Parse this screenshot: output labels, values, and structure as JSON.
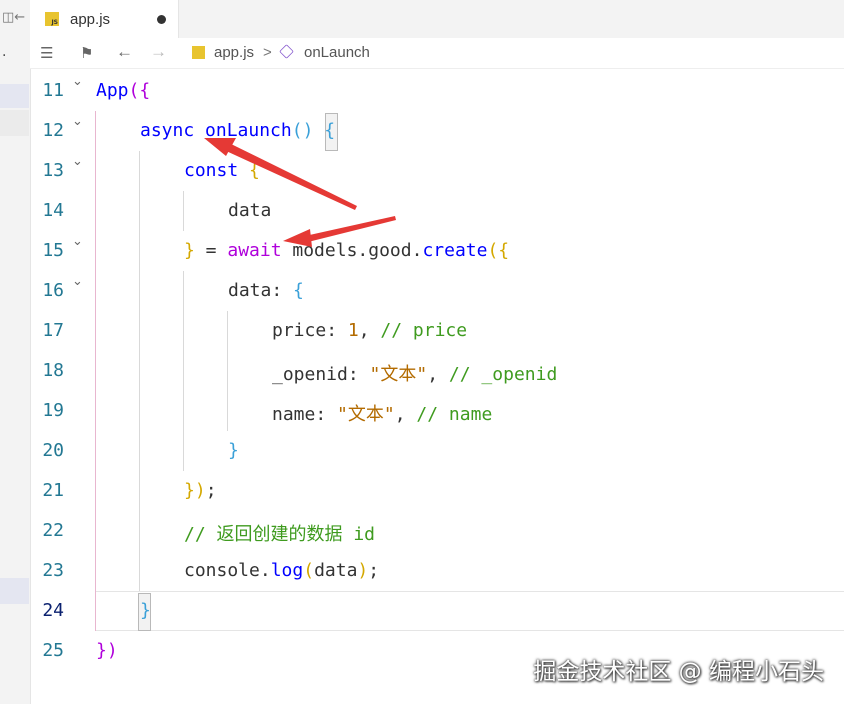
{
  "tab": {
    "filename": "app.js"
  },
  "breadcrumb": {
    "file": "app.js",
    "separator": ">",
    "symbol": "onLaunch"
  },
  "left_panel": {
    "glyph": "◫←",
    "dot": "."
  },
  "line_numbers": [
    "11",
    "12",
    "13",
    "14",
    "15",
    "16",
    "17",
    "18",
    "19",
    "20",
    "21",
    "22",
    "23",
    "24",
    "25"
  ],
  "active_line": "24",
  "code": {
    "l11": {
      "a": "App",
      "b": "({"
    },
    "l12": {
      "kw": "async",
      "fn": "onLaunch",
      "p": "()",
      "b": "{"
    },
    "l13": {
      "kw": "const",
      "b": "{"
    },
    "l14": {
      "t": "data"
    },
    "l15": {
      "b": "}",
      "eq": " = ",
      "kw": "await",
      "obj": " models.good.",
      "fn": "create",
      "p": "({"
    },
    "l16": {
      "t": "data",
      "c": ": ",
      "b": "{"
    },
    "l17": {
      "t": "price",
      "c": ": ",
      "num": "1",
      "cm": ", ",
      "cmt": "// price"
    },
    "l18": {
      "t": "_openid",
      "c": ": ",
      "str": "\"文本\"",
      "cm": ", ",
      "cmt": "// _openid"
    },
    "l19": {
      "t": "name",
      "c": ": ",
      "str": "\"文本\"",
      "cm": ", ",
      "cmt": "// name"
    },
    "l20": {
      "b": "}"
    },
    "l21": {
      "b": "})",
      "s": ";"
    },
    "l22": {
      "cmt": "// 返回创建的数据 id"
    },
    "l23": {
      "obj": "console.",
      "fn": "log",
      "p1": "(",
      "t": "data",
      "p2": ")",
      "s": ";"
    },
    "l24": {
      "b": "}"
    },
    "l25": {
      "b": "})"
    }
  },
  "watermark": "掘金技术社区 @ 编程小石头",
  "colors": {
    "arrow": "#e53935",
    "keyword": "#0000ff",
    "await": "#af00db",
    "comment": "#008000",
    "string": "#a31515"
  }
}
